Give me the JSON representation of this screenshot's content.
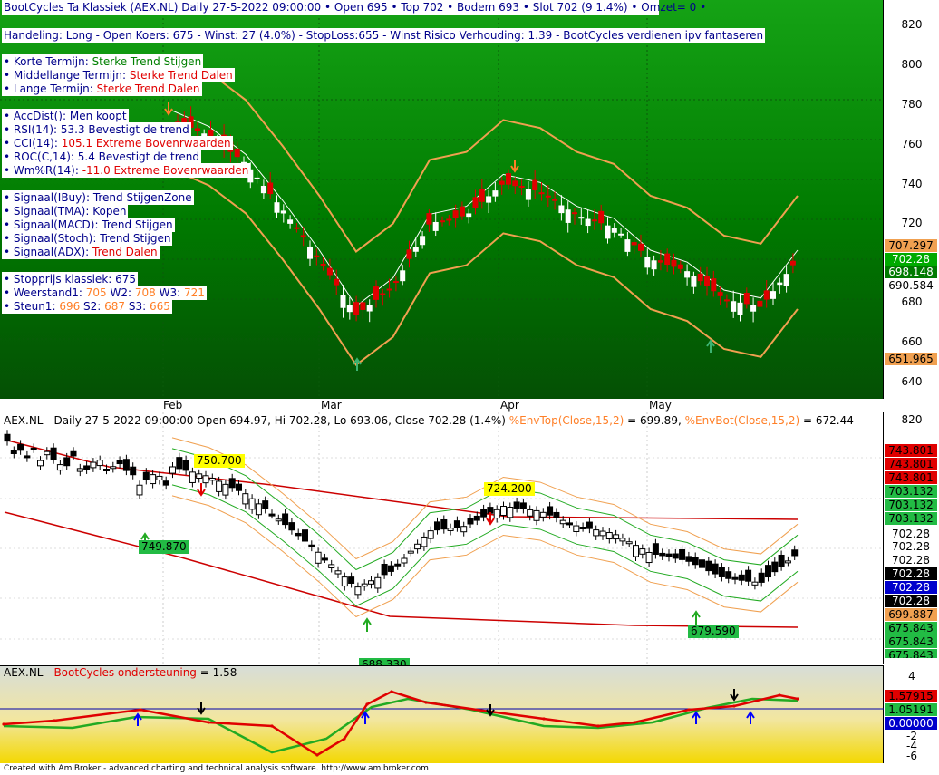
{
  "header": {
    "title": "BootCycles Ta Klassiek (AEX.NL) Daily  27-5-2022 09:00:00  •  Open 695  •  Top 702  •  Bodem 693  •  Slot 702 (9 1.4%)  • Omzet= 0   •",
    "trade": "Handeling: Long - Open Koers: 675 - Winst: 27 (4.0%) - StopLoss:655 - Winst Risico Verhouding: 1.39 - BootCycles verdienen ipv fantaseren"
  },
  "info": {
    "korte_label": "• Korte Termijn: ",
    "korte_val": "Sterke Trend Stijgen",
    "midden_label": "• Middellange Termijn: ",
    "midden_val": "Sterke Trend Dalen",
    "lange_label": "• Lange Termijn: ",
    "lange_val": "Sterke Trend Dalen",
    "accdist": "• AccDist(): Men koopt",
    "rsi_label": "• RSI(14): ",
    "rsi_val": "53.3 Bevestigt de trend",
    "cci_label": "• CCI(14): ",
    "cci_val": "105.1 Extreme Bovenrwaarden",
    "roc_label": "• ROC(C,14): ",
    "roc_val": "5.4 Bevestigt de trend",
    "wmr_label": "• Wm%R(14): ",
    "wmr_val": "-11.0 Extreme Bovenrwaarden",
    "ibuy_label": "• Signaal(IBuy): ",
    "ibuy_val": "Trend StijgenZone",
    "tma_label": "• Signaal(TMA): ",
    "tma_val": "Kopen",
    "macd_label": "• Signaal(MACD): ",
    "macd_val": "Trend Stijgen",
    "stoch_label": "• Signaal(Stoch): ",
    "stoch_val": "Trend Stijgen",
    "adx_label": "• Signaal(ADX): ",
    "adx_val": "Trend Dalen",
    "stop": "• Stopprijs klassiek: 675",
    "weer_label": "• Weerstand1: ",
    "w1": "705",
    "w2l": " W2: ",
    "w2": "708",
    "w3l": " W3: ",
    "w3": "721",
    "steun_label": "• Steun1: ",
    "s1": "696",
    "s2l": "  S2: ",
    "s2": "687",
    "s3l": "  S3: ",
    "s3": "665"
  },
  "pane2": {
    "head_a": "AEX.NL - Daily 27-5-2022 09:00:00 Open 694.97, Hi 702.28, Lo 693.06, Close 702.28 (1.4%) ",
    "head_b": "%EnvTop(Close,15,2)",
    "head_c": " = 699.89, ",
    "head_d": "%EnvBot(Close,15,2)",
    "head_e": " = 672.44",
    "ann1": "750.700",
    "ann2": "724.200",
    "ann3": "749.870",
    "ann4": "688.330",
    "ann5": "679.590"
  },
  "pane3": {
    "head_a": "AEX.NL - ",
    "head_b": "BootCycles ondersteuning",
    "head_c": " = 1.58"
  },
  "months": [
    "Feb",
    "Mar",
    "Apr",
    "May"
  ],
  "axis1": [
    "820",
    "800",
    "780",
    "760",
    "740",
    "720",
    "700",
    "680",
    "660",
    "640"
  ],
  "tags1": [
    "707.297",
    "702.28",
    "698.148",
    "690.584",
    "651.965"
  ],
  "axis2": [
    "820"
  ],
  "tags2": [
    "743.801",
    "743.801",
    "743.801",
    "703.132",
    "703.132",
    "703.132",
    "702.28",
    "702.28",
    "702.28",
    "702.28",
    "702.28",
    "699.887",
    "675.843",
    "675.843",
    "675.843"
  ],
  "axis3": [
    "4",
    "2",
    "0",
    "-2",
    "-4",
    "-6"
  ],
  "tags3": [
    "1.57915",
    "1.05191",
    "0.00000"
  ],
  "footer": "Created with AmiBroker - advanced charting and technical analysis software. http://www.amibroker.com",
  "colors": {
    "bull": "#ffffff",
    "bear": "#e00000",
    "upper_band": "#f0a050",
    "lower_band": "#f0a050",
    "mid": "#ffffff",
    "up_arrow": "#3cb371",
    "down_arrow": "#ff7f27"
  },
  "chart_data": {
    "type": "line",
    "title": "BootCycles Ta Klassiek (AEX.NL) Daily",
    "ylim": [
      630,
      830
    ],
    "x": [
      "Feb",
      "Mar",
      "Apr",
      "May"
    ],
    "series": [
      {
        "name": "Slot",
        "values": [
          770,
          762,
          748,
          725,
          700,
          672,
          686,
          718,
          722,
          738,
          734,
          722,
          716,
          700,
          694,
          680,
          676,
          700
        ]
      },
      {
        "name": "BootCycles ondersteuning",
        "values": [
          -2,
          -1,
          0,
          -3,
          -1,
          4,
          1,
          0,
          -1,
          0,
          1,
          1,
          1.58
        ]
      }
    ]
  }
}
